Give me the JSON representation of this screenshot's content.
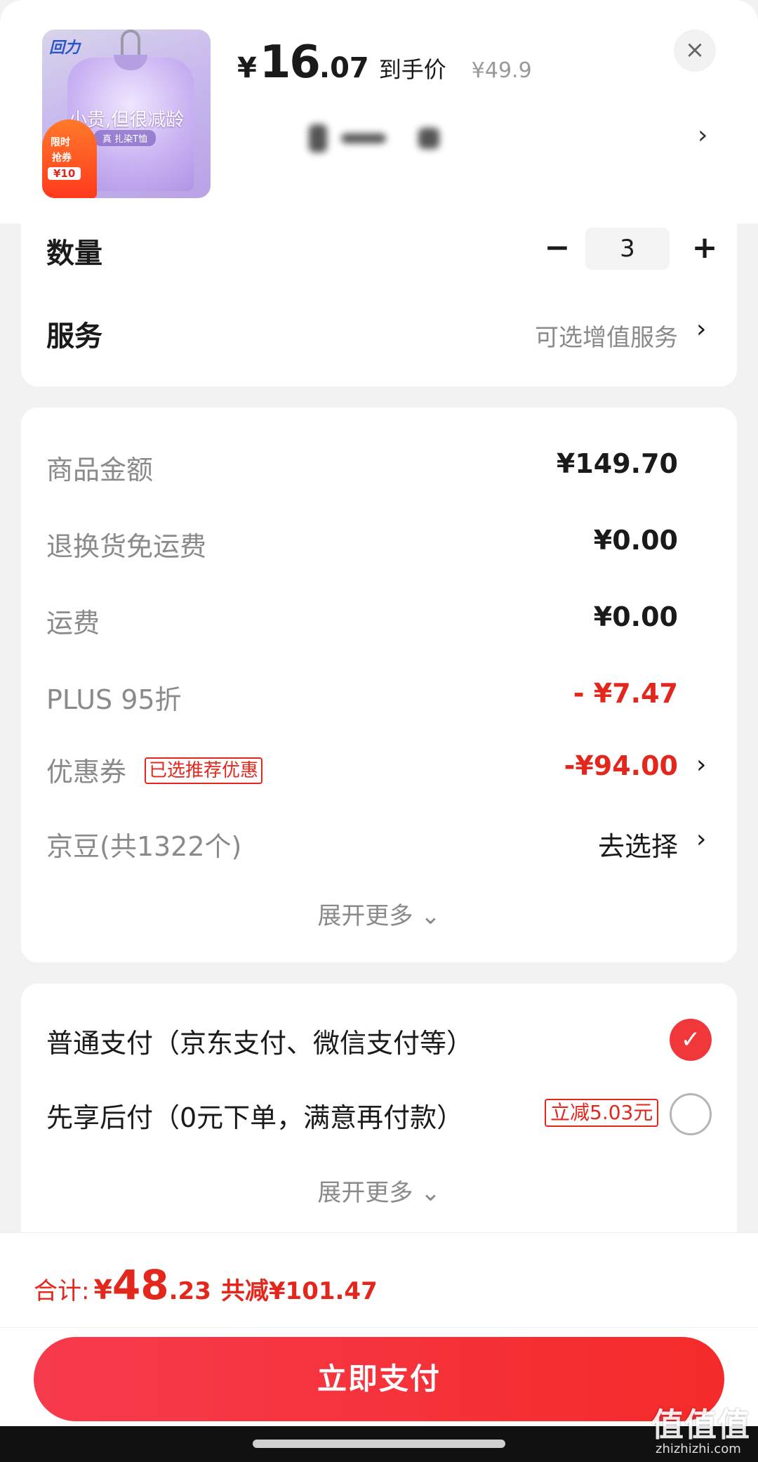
{
  "product": {
    "image_alt": "lavender tie-dye t-shirt",
    "image_brand": "回力",
    "image_slogan": "小贵,但很减龄",
    "image_pill": "真 扎染T恤",
    "image_flame_1": "限时",
    "image_flame_2": "抢券",
    "image_flame_3": "¥10",
    "price_symbol": "¥",
    "price_integer": "16",
    "price_decimal": ".07",
    "price_tag": "到手价",
    "original_price": "¥49.9",
    "close_icon": "×",
    "spec_chevron": "›"
  },
  "quantity_card": {
    "quantity_label": "数量",
    "minus": "−",
    "quantity_value": "3",
    "plus": "+",
    "service_label": "服务",
    "service_hint": "可选增值服务",
    "service_chevron": "›"
  },
  "fees": {
    "rows": [
      {
        "label": "商品金额",
        "value": "¥149.70"
      },
      {
        "label": "退换货免运费",
        "value": "¥0.00"
      },
      {
        "label": "运费",
        "value": "¥0.00"
      },
      {
        "label": "PLUS 95折",
        "value": "- ¥7.47"
      },
      {
        "label": "优惠券",
        "badge": "已选推荐优惠",
        "value": "-¥94.00"
      },
      {
        "label": "京豆(共1322个)",
        "value": "去选择"
      }
    ],
    "chevron": "›",
    "expand_more": "展开更多 ⌄"
  },
  "payment": {
    "options": [
      {
        "label": "普通支付（京东支付、微信支付等）",
        "selected": true
      },
      {
        "label": "先享后付（0元下单，满意再付款）",
        "badge": "立减5.03元",
        "selected": false
      }
    ],
    "check_icon": "✓",
    "expand_more": "展开更多 ⌄"
  },
  "footer": {
    "total_label": "合计:",
    "total_symbol": "¥",
    "total_integer": "48",
    "total_decimal": ".23",
    "total_saving": "共减¥101.47",
    "pay_button": "立即支付"
  },
  "watermark": {
    "main": "值值值",
    "sub": "zhizhizhi.com"
  },
  "colors": {
    "accent_red": "#e3271d",
    "button_red": "#f52a2a",
    "muted_text": "#8a8a8a",
    "background": "#f2f2f2"
  }
}
